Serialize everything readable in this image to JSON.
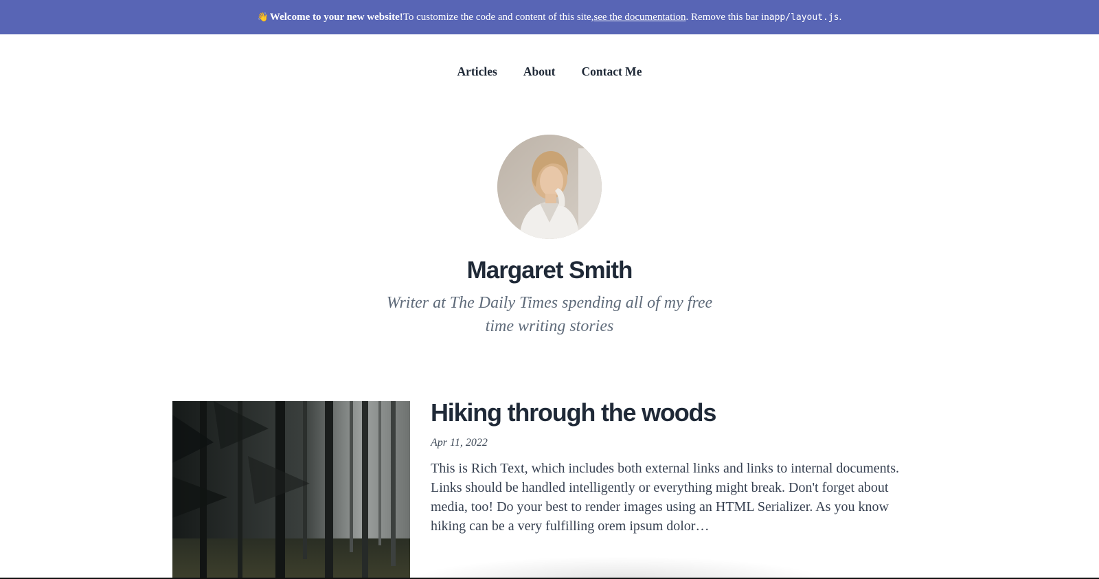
{
  "banner": {
    "emoji": "👋",
    "bold": "Welcome to your new website!",
    "text1": " To customize the code and content of this site, ",
    "link": "see the documentation",
    "text2": ". Remove this bar in ",
    "code": "app/layout.js",
    "text3": "."
  },
  "nav": {
    "items": [
      "Articles",
      "About",
      "Contact Me"
    ]
  },
  "profile": {
    "name": "Margaret Smith",
    "tagline": "Writer at The Daily Times spending all of my free time writing stories"
  },
  "article": {
    "title": "Hiking through the woods",
    "date": "Apr 11, 2022",
    "excerpt": "This is Rich Text, which includes both external links and links to internal documents. Links should be handled intelligently or everything might break. Don't forget about media, too! Do your best to render images using an HTML Serializer. As you know hiking can be a very fulfilling orem ipsum dolor…"
  },
  "colors": {
    "banner_bg": "#5865b5",
    "heading": "#1f2937",
    "muted": "#5f6b7a"
  }
}
